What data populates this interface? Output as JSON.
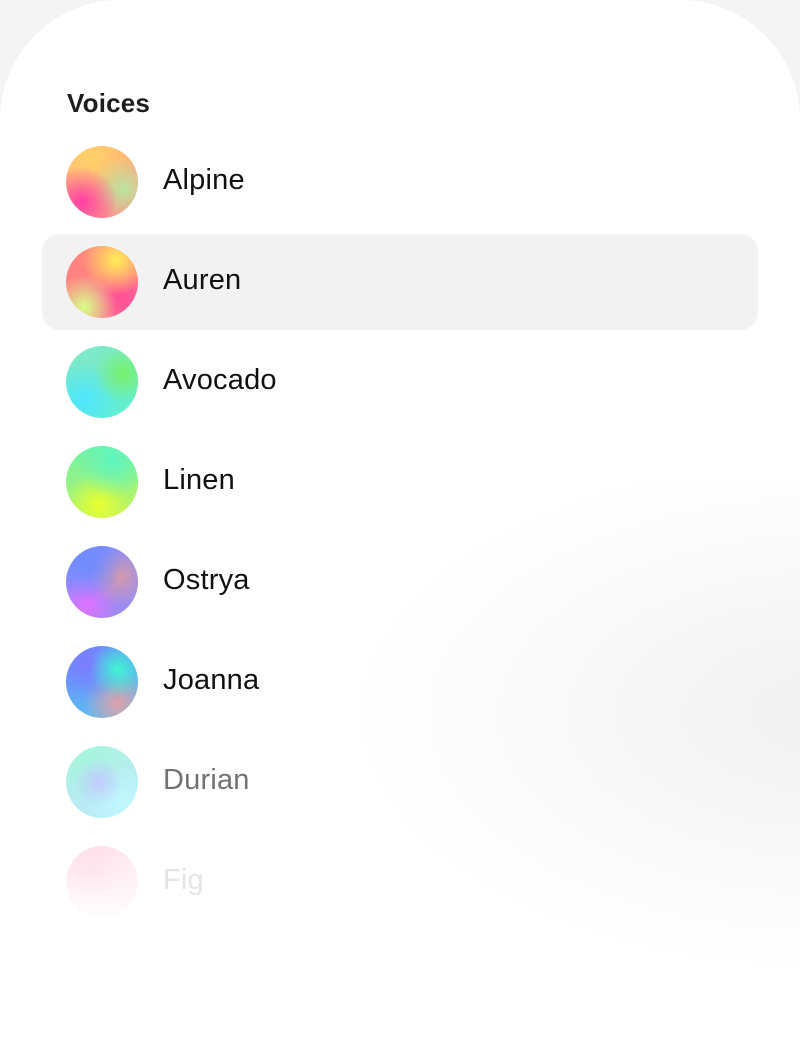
{
  "section": {
    "title": "Voices"
  },
  "voices": [
    {
      "name": "Alpine",
      "avatar_icon": "voice-orb-alpine",
      "selected": false
    },
    {
      "name": "Auren",
      "avatar_icon": "voice-orb-auren",
      "selected": true
    },
    {
      "name": "Avocado",
      "avatar_icon": "voice-orb-avocado",
      "selected": false
    },
    {
      "name": "Linen",
      "avatar_icon": "voice-orb-linen",
      "selected": false
    },
    {
      "name": "Ostrya",
      "avatar_icon": "voice-orb-ostrya",
      "selected": false
    },
    {
      "name": "Joanna",
      "avatar_icon": "voice-orb-joanna",
      "selected": false
    },
    {
      "name": "Durian",
      "avatar_icon": "voice-orb-durian",
      "selected": false
    },
    {
      "name": "Fig",
      "avatar_icon": "voice-orb-fig",
      "selected": false
    }
  ],
  "colors": {
    "selected_row_background": "#f2f2f2",
    "text_primary": "#111111"
  }
}
